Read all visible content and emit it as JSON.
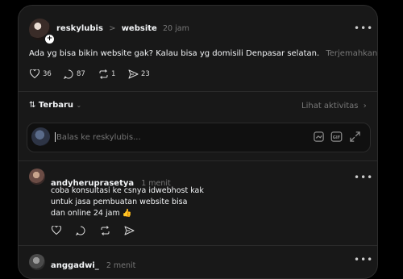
{
  "post": {
    "username": "reskylubis",
    "separator": ">",
    "topic": "website",
    "time": "20 jam",
    "text": "Ada yg bisa bikin website gak? Kalau bisa yg domisili Denpasar selatan.",
    "translate": "Terjemahkan",
    "likes": "36",
    "comments": "87",
    "reposts": "1",
    "shares": "23"
  },
  "sort": {
    "label": "Terbaru",
    "activity": "Lihat aktivitas"
  },
  "reply_box": {
    "placeholder": "Balas ke reskylubis..."
  },
  "replies": [
    {
      "username": "andyheruprasetya",
      "time": "1 menit",
      "lines": [
        "coba konsultasi ke csnya idwebhost kak",
        "untuk jasa pembuatan website bisa",
        "dan online 24 jam 👍"
      ]
    },
    {
      "username": "anggadwi_",
      "time": "2 menit"
    }
  ]
}
